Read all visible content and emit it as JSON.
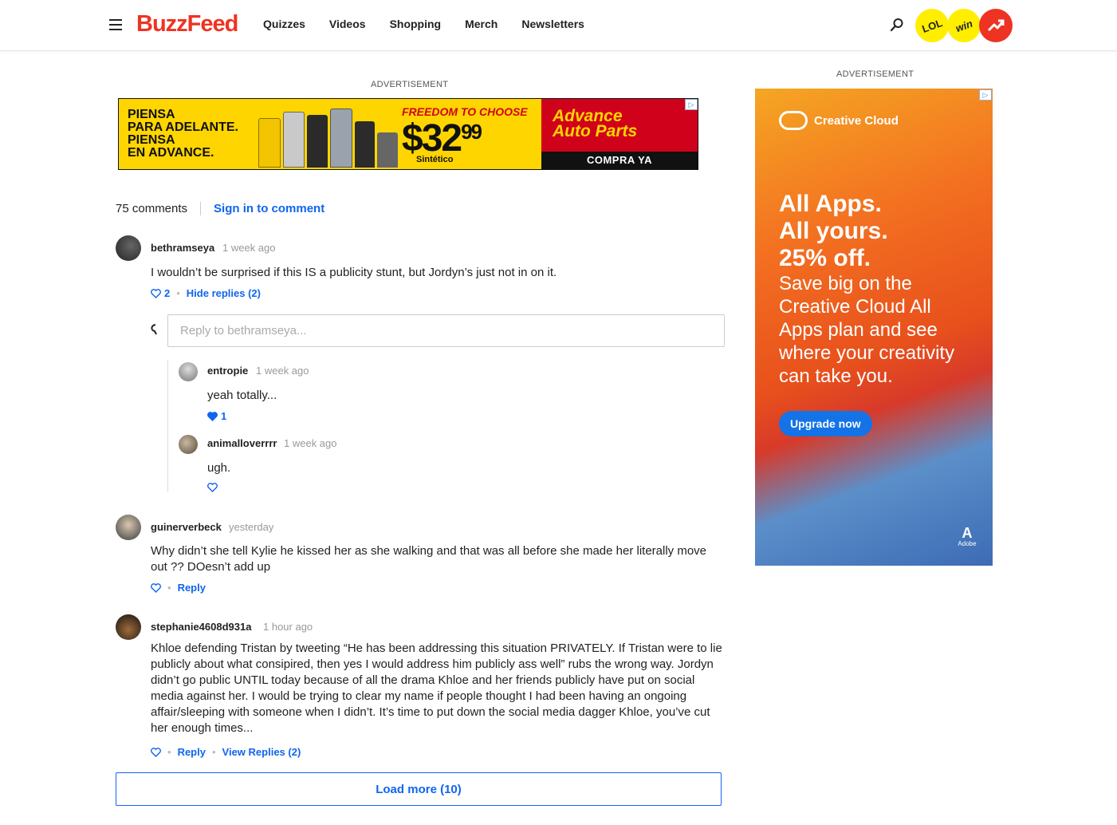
{
  "header": {
    "logo": "BuzzFeed",
    "nav": [
      "Quizzes",
      "Videos",
      "Shopping",
      "Merch",
      "Newsletters"
    ],
    "badges": {
      "lol": "LOL",
      "win": "win"
    },
    "colors": {
      "brand": "#ee3322",
      "badge_yellow": "#ffee00",
      "link_blue": "#0f65ef"
    }
  },
  "ads": {
    "label_left": "ADVERTISEMENT",
    "label_right": "ADVERTISEMENT",
    "banner": {
      "headline": "PIENSA\nPARA ADELANTE.\nPIENSA\nEN ADVANCE.",
      "freedom": "FREEDOM TO CHOOSE",
      "price": "$32",
      "price_cents": "99",
      "sint": "Sintético",
      "brand": "Advance\nAuto Parts",
      "cta": "COMPRA YA"
    },
    "side": {
      "brand": "Creative Cloud",
      "headline": "All Apps.\nAll yours.\n25% off.",
      "body": "Save big on the Creative Cloud All Apps plan and see where your creativity can take you.",
      "cta": "Upgrade now",
      "maker": "Adobe"
    }
  },
  "comments_section": {
    "count_label": "75 comments",
    "signin_label": "Sign in to comment",
    "reply_placeholder": "Reply to bethramseya...",
    "load_more": "Load more (10)",
    "comments": [
      {
        "user": "bethramseya",
        "time": "1 week ago",
        "text": "I wouldn’t be surprised if this IS a publicity stunt, but Jordyn’s just not in on it.",
        "likes": "2",
        "link": "Hide replies (2)"
      },
      {
        "user": "guinerverbeck",
        "time": "yesterday",
        "text": "Why didn’t she tell Kylie he kissed her as she walking and that was all before she made her literally move out ?? DOesn’t add up",
        "link": "Reply"
      },
      {
        "user": "stephanie4608d931a",
        "time": "1 hour ago",
        "text": "Khloe defending Tristan by tweeting “He has been addressing this situation PRIVATELY. If Tristan were to lie publicly about what consipired, then yes I would address him publicly ass well” rubs the wrong way. Jordyn didn’t go public UNTIL today because of all the drama Khloe and her friends publicly have put on social media against her. I would be trying to clear my name if people thought I had been having an ongoing affair/sleeping with someone when I didn’t. It’s time to put down the social media dagger Khloe, you’ve cut her enough times...",
        "link": "Reply",
        "link2": "View Replies (2)"
      }
    ],
    "replies": [
      {
        "user": "entropie",
        "time": "1 week ago",
        "text": "yeah totally...",
        "likes": "1"
      },
      {
        "user": "animalloverrrr",
        "time": "1 week ago",
        "text": "ugh."
      }
    ]
  }
}
